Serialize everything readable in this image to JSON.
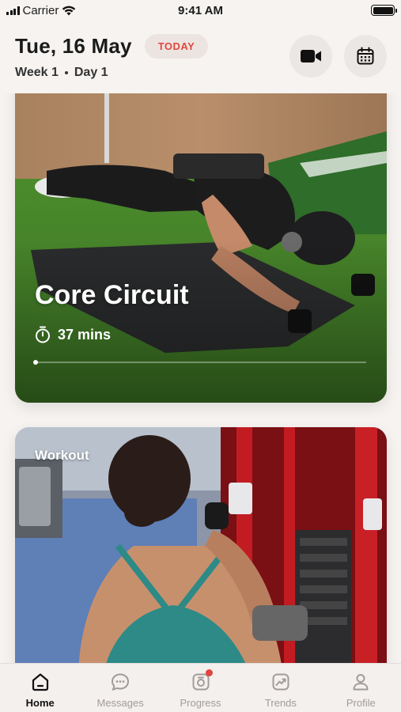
{
  "status_bar": {
    "carrier": "Carrier",
    "time": "9:41 AM"
  },
  "header": {
    "date": "Tue, 16 May",
    "today_badge": "TODAY",
    "week": "Week 1",
    "day": "Day 1",
    "accent_color": "#e2463f"
  },
  "cards": [
    {
      "title": "Core Circuit",
      "duration": "37 mins",
      "progress": 0.01
    },
    {
      "label": "Workout"
    }
  ],
  "tabs": [
    {
      "label": "Home",
      "icon": "home-icon",
      "active": true
    },
    {
      "label": "Messages",
      "icon": "chat-icon",
      "active": false
    },
    {
      "label": "Progress",
      "icon": "camera-icon",
      "active": false,
      "has_badge": true
    },
    {
      "label": "Trends",
      "icon": "trend-icon",
      "active": false
    },
    {
      "label": "Profile",
      "icon": "person-icon",
      "active": false
    }
  ]
}
